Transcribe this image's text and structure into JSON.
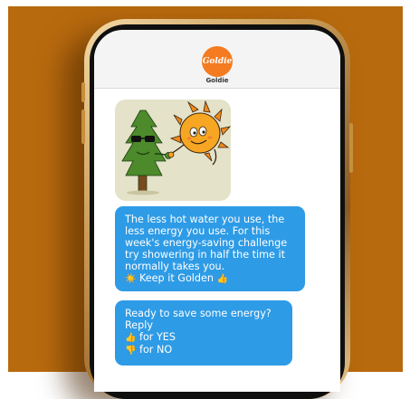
{
  "contact": {
    "logo_text": "Goldie",
    "name": "Goldie"
  },
  "illustration": {
    "description_icon": "tree-and-sun-fistbump-icon"
  },
  "messages": [
    {
      "lines": [
        "The less hot water you use, the",
        "less energy you use. For this",
        "week's energy-saving challenge",
        "try showering in half the time it",
        "normally takes you."
      ],
      "sign_off": "Keep it Golden",
      "sign_off_prefix_icon": "sun-emoji",
      "sign_off_suffix_icon": "thumbs-up-emoji"
    },
    {
      "lines": [
        "Ready to save some energy?",
        "Reply"
      ],
      "options": [
        {
          "icon": "thumbs-up-emoji",
          "label": "for YES"
        },
        {
          "icon": "thumbs-down-emoji",
          "label": "for NO"
        }
      ]
    }
  ],
  "colors": {
    "background": "#b86a0e",
    "bubble": "#2e9be6",
    "logo": "#f47b20"
  }
}
